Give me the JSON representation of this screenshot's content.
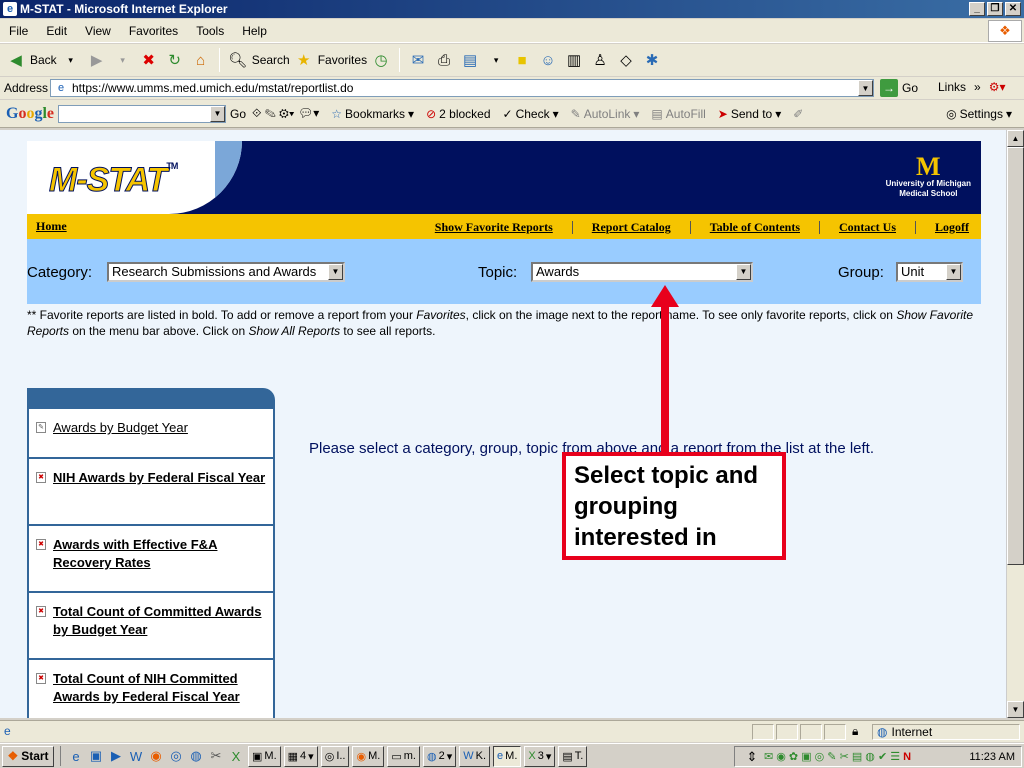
{
  "window": {
    "title": "M-STAT - Microsoft Internet Explorer"
  },
  "menu": [
    "File",
    "Edit",
    "View",
    "Favorites",
    "Tools",
    "Help"
  ],
  "toolbar": {
    "back": "Back",
    "search": "Search",
    "favorites": "Favorites"
  },
  "address": {
    "label": "Address",
    "url": "https://www.umms.med.umich.edu/mstat/reportlist.do",
    "go": "Go",
    "links": "Links"
  },
  "google_bar": {
    "go": "Go",
    "bookmarks": "Bookmarks",
    "blocked": "2 blocked",
    "check": "Check",
    "autolink": "AutoLink",
    "autofill": "AutoFill",
    "send_to": "Send to",
    "settings": "Settings"
  },
  "header": {
    "logo": "M-STAT",
    "tm": "TM",
    "umich_line1": "University of Michigan",
    "umich_line2": "Medical School"
  },
  "nav": {
    "home": "Home",
    "links": [
      "Show Favorite Reports",
      "Report Catalog",
      "Table of Contents",
      "Contact Us",
      "Logoff"
    ]
  },
  "filters": {
    "category_label": "Category:",
    "category_value": "Research Submissions and Awards",
    "topic_label": "Topic:",
    "topic_value": "Awards",
    "group_label": "Group:",
    "group_value": "Unit"
  },
  "note": {
    "p1": "** Favorite reports are listed in bold. To add or remove a report from your ",
    "i1": "Favorites",
    "p2": ", click on the image next to the report name. To see only favorite reports, click on ",
    "i2": "Show Favorite Reports",
    "p3": " on the menu bar above. Click on ",
    "i3": "Show All Reports",
    "p4": " to see all reports."
  },
  "reports": [
    {
      "label": "Awards by Budget Year",
      "favorite": false
    },
    {
      "label": "NIH Awards by Federal Fiscal Year",
      "favorite": true
    },
    {
      "label": "Awards with Effective F&A Recovery Rates",
      "favorite": true
    },
    {
      "label": "Total Count of Committed Awards by Budget Year",
      "favorite": true
    },
    {
      "label": "Total Count of NIH Committed Awards by Federal Fiscal Year",
      "favorite": true
    }
  ],
  "message": "Please select a category, group, topic from above and a report from the list at the left.",
  "callout": "Select topic and grouping interested in",
  "status": {
    "zone": "Internet"
  },
  "taskbar": {
    "start": "Start",
    "tasks": [
      "M.",
      "4",
      "I..",
      "M.",
      "m.",
      "2",
      "K.",
      "M.",
      "3",
      "T."
    ],
    "clock": "11:23 AM"
  },
  "colors": {
    "banner": "#00105e",
    "maize": "#f5c400",
    "filter_bg": "#99ccff",
    "sidebar_border": "#336699",
    "callout": "#e8001c"
  }
}
